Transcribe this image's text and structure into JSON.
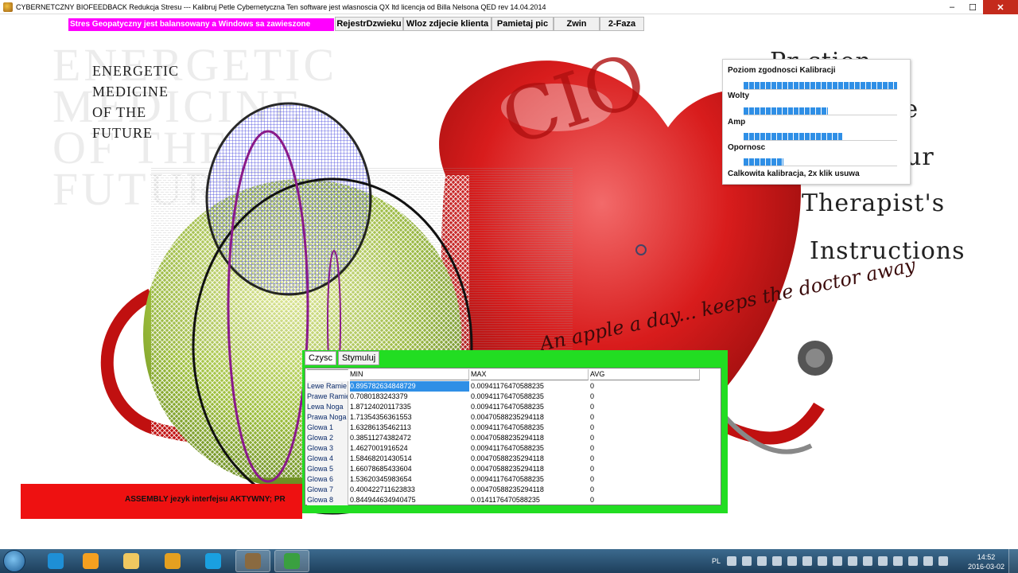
{
  "window": {
    "title": "CYBERNETCZNY BIOFEEDBACK   Redukcja Stresu --- Kalibruj Petle Cybernetyczna   Ten software jest wlasnoscia QX ltd licencja od Billa Nelsona QED rev 14.04.2014",
    "minimize": "–",
    "maximize": "☐",
    "close": "✕"
  },
  "toolbar": {
    "status": "Stres Geopatyczny jest balansowany a Windows sa zawieszone",
    "buttons": [
      "RejestrDzwieku",
      "Wloz zdjecie klienta",
      "Pamietaj pic",
      "Zwin",
      "2-Faza"
    ]
  },
  "background": {
    "watermark": [
      "ENERGETIC",
      "MEDICINE",
      "OF THE",
      "FUTURE"
    ],
    "energetic_lines": [
      "ENERGETIC",
      "MEDICINE",
      "OF THE",
      "FUTURE"
    ],
    "heart_letters": "CIO",
    "right_lines": [
      "Pr      ction",
      "       se",
      "     our",
      "Therapist's",
      "Instructions"
    ],
    "script": "An apple a day... keeps the doctor away"
  },
  "calibration": {
    "title": "Poziom zgodnosci Kalibracji",
    "bars": [
      {
        "label": "",
        "level": 1.0
      },
      {
        "label": "Wolty",
        "level": 0.55
      },
      {
        "label": "Amp",
        "level": 0.64
      },
      {
        "label": "Opornosc",
        "level": 0.26
      }
    ],
    "footer": "Calkowita kalibracja, 2x klik usuwa"
  },
  "table": {
    "tabs": [
      "Czysc",
      "Stymuluj"
    ],
    "columns": [
      "",
      "MIN",
      "MAX",
      "AVG"
    ],
    "rows": [
      [
        "Lewe Ramie",
        "0.895782634848729",
        "0.00941176470588235",
        "0"
      ],
      [
        "Prawe Ramie",
        "0.7080183243379",
        "0.00941176470588235",
        "0"
      ],
      [
        "Lewa Noga",
        "1.87124020117335",
        "0.00941176470588235",
        "0"
      ],
      [
        "Prawa Noga",
        "1.71354356361553",
        "0.00470588235294118",
        "0"
      ],
      [
        "Glowa 1",
        "1.63286135462113",
        "0.00941176470588235",
        "0"
      ],
      [
        "Glowa 2",
        "0.38511274382472",
        "0.00470588235294118",
        "0"
      ],
      [
        "Glowa 3",
        "1.4627001916524",
        "0.00941176470588235",
        "0"
      ],
      [
        "Glowa 4",
        "1.58468201430514",
        "0.00470588235294118",
        "0"
      ],
      [
        "Glowa 5",
        "1.66078685433604",
        "0.00470588235294118",
        "0"
      ],
      [
        "Glowa 6",
        "1.53620345983654",
        "0.00941176470588235",
        "0"
      ],
      [
        "Glowa 7",
        "0.400422711623833",
        "0.00470588235294118",
        "0"
      ],
      [
        "Glowa 8",
        "0.844944634940475",
        "0.0141176470588235",
        "0"
      ]
    ]
  },
  "redbar": {
    "text": "ASSEMBLY jezyk interfejsu AKTYWNY; PR"
  },
  "taskbar": {
    "language": "PL",
    "time": "14:52",
    "date": "2016-03-02",
    "apps": [
      "ie-icon",
      "media-player-icon",
      "explorer-icon",
      "chrome-icon",
      "skype-icon",
      "biofeedback-app-icon",
      "green-app-icon"
    ],
    "app_colors": [
      "#1e8fd6",
      "#f4a020",
      "#f0c860",
      "#e4a020",
      "#1aa0e0",
      "#8a6a40",
      "#3aa040"
    ]
  }
}
